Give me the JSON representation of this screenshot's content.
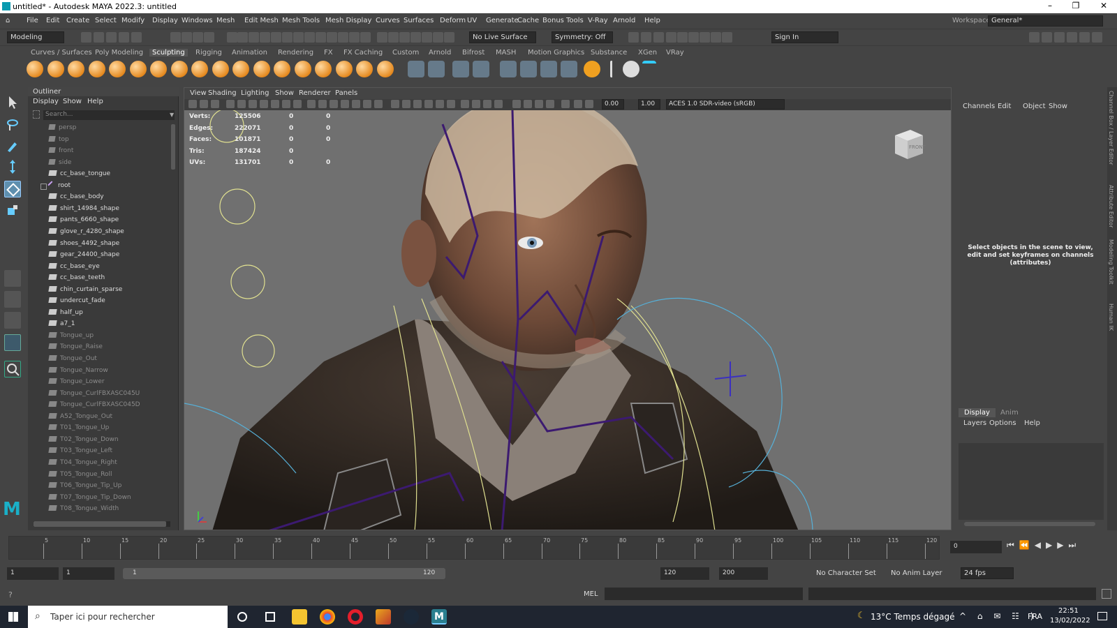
{
  "title_bar": {
    "title": "untitled* - Autodesk MAYA 2022.3: untitled",
    "min": "–",
    "max": "❐",
    "close": "✕"
  },
  "menu": [
    "File",
    "Edit",
    "Create",
    "Select",
    "Modify",
    "Display",
    "Windows",
    "Mesh",
    "Edit Mesh",
    "Mesh Tools",
    "Mesh Display",
    "Curves",
    "Surfaces",
    "Deform",
    "UV",
    "Generate",
    "Cache",
    "Bonus Tools",
    "V-Ray",
    "Arnold",
    "Help"
  ],
  "workspace": {
    "label": "Workspace:",
    "value": "General*"
  },
  "status_line": {
    "mode": "Modeling",
    "live_surface": "No Live Surface",
    "symmetry": "Symmetry: Off",
    "sign_in": "Sign In"
  },
  "shelf_tabs": [
    "Curves / Surfaces",
    "Poly Modeling",
    "Sculpting",
    "Rigging",
    "Animation",
    "Rendering",
    "FX",
    "FX Caching",
    "Custom",
    "Arnold",
    "Bifrost",
    "MASH",
    "Motion Graphics",
    "Substance",
    "XGen",
    "VRay"
  ],
  "active_shelf": "Sculpting",
  "outliner": {
    "title": "Outliner",
    "menu": [
      "Display",
      "Show",
      "Help"
    ],
    "search_placeholder": "Search...",
    "items": [
      {
        "label": "persp",
        "dim": true,
        "type": "cam"
      },
      {
        "label": "top",
        "dim": true,
        "type": "cam"
      },
      {
        "label": "front",
        "dim": true,
        "type": "cam"
      },
      {
        "label": "side",
        "dim": true,
        "type": "cam"
      },
      {
        "label": "cc_base_tongue",
        "dim": false,
        "type": "mesh"
      },
      {
        "label": "root",
        "dim": false,
        "type": "joint"
      },
      {
        "label": "cc_base_body",
        "dim": false,
        "type": "mesh"
      },
      {
        "label": "shirt_14984_shape",
        "dim": false,
        "type": "mesh"
      },
      {
        "label": "pants_6660_shape",
        "dim": false,
        "type": "mesh"
      },
      {
        "label": "glove_r_4280_shape",
        "dim": false,
        "type": "mesh"
      },
      {
        "label": "shoes_4492_shape",
        "dim": false,
        "type": "mesh"
      },
      {
        "label": "gear_24400_shape",
        "dim": false,
        "type": "mesh"
      },
      {
        "label": "cc_base_eye",
        "dim": false,
        "type": "mesh"
      },
      {
        "label": "cc_base_teeth",
        "dim": false,
        "type": "mesh"
      },
      {
        "label": "chin_curtain_sparse",
        "dim": false,
        "type": "mesh"
      },
      {
        "label": "undercut_fade",
        "dim": false,
        "type": "mesh"
      },
      {
        "label": "half_up",
        "dim": false,
        "type": "mesh"
      },
      {
        "label": "a7_1",
        "dim": false,
        "type": "mesh"
      },
      {
        "label": "Tongue_up",
        "dim": true,
        "type": "mesh"
      },
      {
        "label": "Tongue_Raise",
        "dim": true,
        "type": "mesh"
      },
      {
        "label": "Tongue_Out",
        "dim": true,
        "type": "mesh"
      },
      {
        "label": "Tongue_Narrow",
        "dim": true,
        "type": "mesh"
      },
      {
        "label": "Tongue_Lower",
        "dim": true,
        "type": "mesh"
      },
      {
        "label": "Tongue_CurlFBXASC045U",
        "dim": true,
        "type": "mesh"
      },
      {
        "label": "Tongue_CurlFBXASC045D",
        "dim": true,
        "type": "mesh"
      },
      {
        "label": "A52_Tongue_Out",
        "dim": true,
        "type": "mesh"
      },
      {
        "label": "T01_Tongue_Up",
        "dim": true,
        "type": "mesh"
      },
      {
        "label": "T02_Tongue_Down",
        "dim": true,
        "type": "mesh"
      },
      {
        "label": "T03_Tongue_Left",
        "dim": true,
        "type": "mesh"
      },
      {
        "label": "T04_Tongue_Right",
        "dim": true,
        "type": "mesh"
      },
      {
        "label": "T05_Tongue_Roll",
        "dim": true,
        "type": "mesh"
      },
      {
        "label": "T06_Tongue_Tip_Up",
        "dim": true,
        "type": "mesh"
      },
      {
        "label": "T07_Tongue_Tip_Down",
        "dim": true,
        "type": "mesh"
      },
      {
        "label": "T08_Tongue_Width",
        "dim": true,
        "type": "mesh"
      }
    ]
  },
  "viewport": {
    "menu": [
      "View",
      "Shading",
      "Lighting",
      "Show",
      "Renderer",
      "Panels"
    ],
    "field1": "0.00",
    "field2": "1.00",
    "colorspace": "ACES 1.0 SDR-video (sRGB)",
    "hud": [
      {
        "label": "Verts:",
        "a": "125506",
        "b": "0",
        "c": "0"
      },
      {
        "label": "Edges:",
        "a": "222071",
        "b": "0",
        "c": "0"
      },
      {
        "label": "Faces:",
        "a": "101871",
        "b": "0",
        "c": "0"
      },
      {
        "label": "Tris:",
        "a": "187424",
        "b": "0",
        "c": ""
      },
      {
        "label": "UVs:",
        "a": "131701",
        "b": "0",
        "c": "0"
      }
    ],
    "viewcube": "FRONT"
  },
  "channel_box": {
    "menu": [
      "Channels",
      "Edit",
      "Object",
      "Show"
    ],
    "message": "Select objects in the scene to view, edit and set keyframes on channels (attributes)"
  },
  "layer_editor": {
    "tabs": [
      "Display",
      "Anim"
    ],
    "menu": [
      "Layers",
      "Options",
      "Help"
    ]
  },
  "side_tabs": [
    "Channel Box / Layer Editor",
    "Attribute Editor",
    "Modeling Toolkit",
    "Human IK"
  ],
  "timeline": {
    "labels": [
      "5",
      "10",
      "15",
      "20",
      "25",
      "30",
      "35",
      "40",
      "45",
      "50",
      "55",
      "60",
      "65",
      "70",
      "75",
      "80",
      "85",
      "90",
      "95",
      "100",
      "105",
      "110",
      "115",
      "120"
    ],
    "current": "0"
  },
  "range": {
    "start": "1",
    "start2": "1",
    "slider_start": "1",
    "slider_end": "120",
    "end": "120",
    "end2": "200",
    "character": "No Character Set",
    "anim_layer": "No Anim Layer",
    "fps": "24 fps"
  },
  "command": {
    "lang": "MEL"
  },
  "taskbar": {
    "search": "Taper ici pour rechercher",
    "weather": "13°C  Temps dégagé",
    "lang": "FRA",
    "time": "22:51",
    "date": "13/02/2022"
  }
}
